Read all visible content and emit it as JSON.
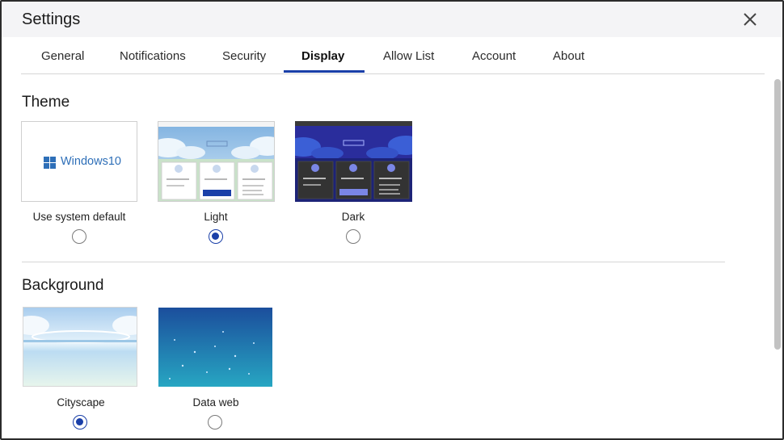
{
  "window": {
    "title": "Settings",
    "close_icon": "close-icon"
  },
  "tabs": [
    {
      "label": "General",
      "active": false
    },
    {
      "label": "Notifications",
      "active": false
    },
    {
      "label": "Security",
      "active": false
    },
    {
      "label": "Display",
      "active": true
    },
    {
      "label": "Allow List",
      "active": false
    },
    {
      "label": "Account",
      "active": false
    },
    {
      "label": "About",
      "active": false
    }
  ],
  "theme": {
    "title": "Theme",
    "options": [
      {
        "label": "Use system default",
        "thumb_text": "Windows10",
        "selected": false
      },
      {
        "label": "Light",
        "selected": true
      },
      {
        "label": "Dark",
        "selected": false
      }
    ]
  },
  "background": {
    "title": "Background",
    "options": [
      {
        "label": "Cityscape",
        "selected": true
      },
      {
        "label": "Data web",
        "selected": false
      }
    ]
  },
  "colors": {
    "accent": "#1a3fa8",
    "dark_thumb_bg": "#2a2d9c",
    "dark_card": "#333333"
  }
}
